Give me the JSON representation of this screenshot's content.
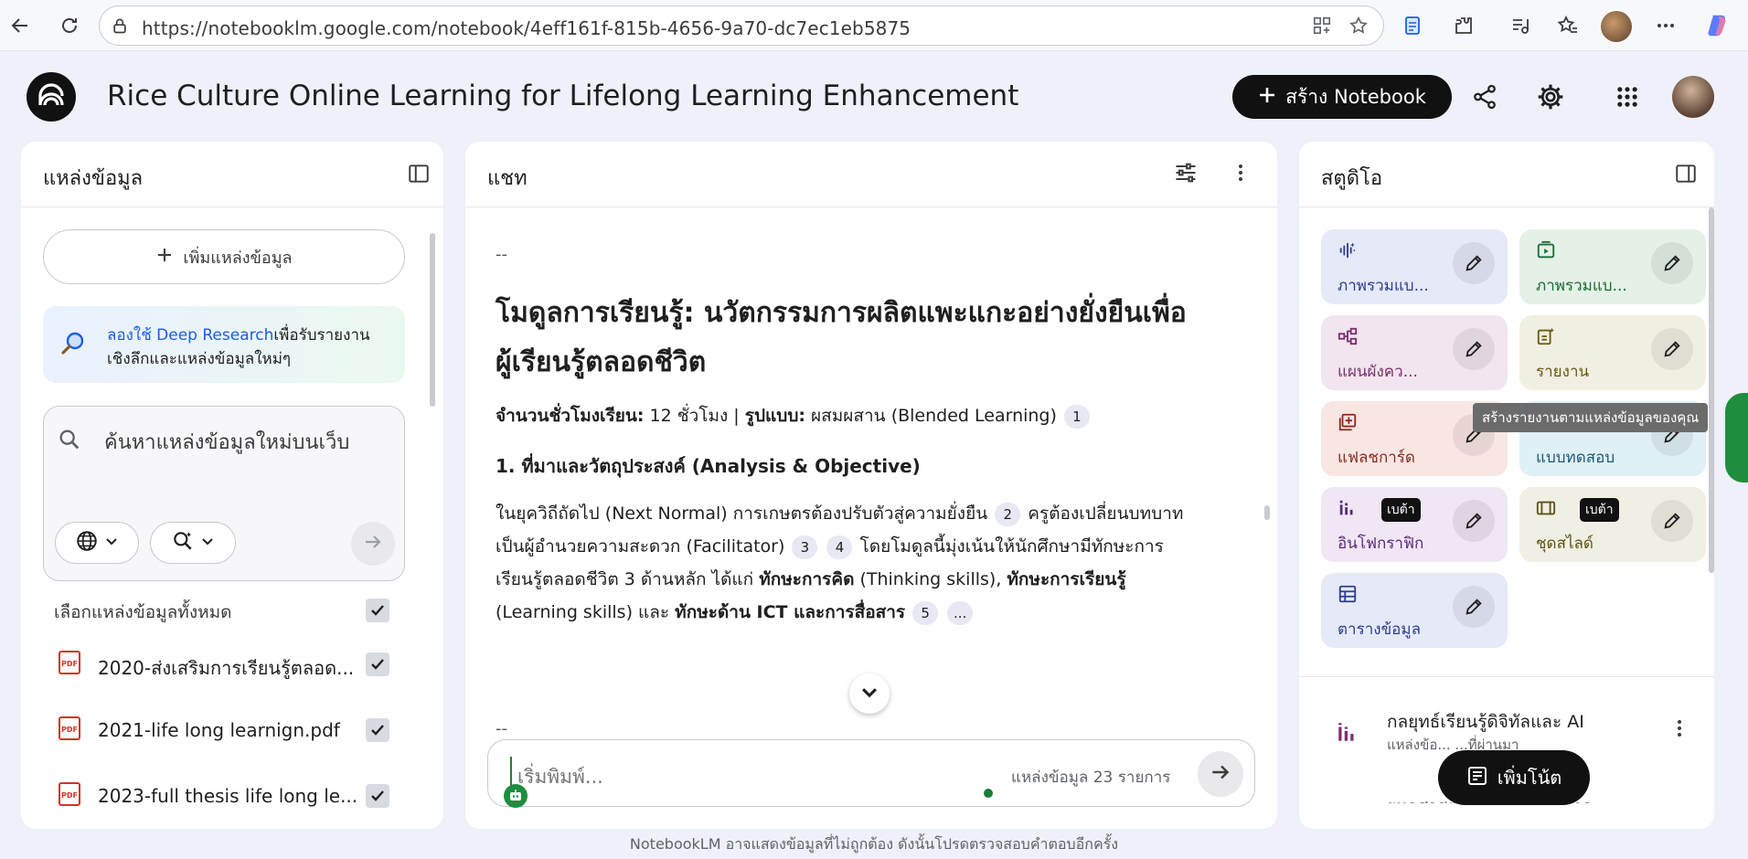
{
  "browser": {
    "url": "https://notebooklm.google.com/notebook/4eff161f-815b-4656-9a70-dc7ec1eb5875"
  },
  "header": {
    "title": "Rice Culture Online Learning for Lifelong Learning Enhancement",
    "create_label": "สร้าง Notebook"
  },
  "sources": {
    "title": "แหล่งข้อมูล",
    "add_label": "เพิ่มแหล่งข้อมูล",
    "deep_link": "ลองใช้ Deep Research",
    "deep_text": "เพื่อรับรายงาน",
    "deep_text2": "เชิงลึกและแหล่งข้อมูลใหม่ๆ",
    "search_placeholder": "ค้นหาแหล่งข้อมูลใหม่บนเว็บ",
    "select_all": "เลือกแหล่งข้อมูลทั้งหมด",
    "items": [
      {
        "name": "2020-ส่งเสริมการเรียนรู้ตลอด..."
      },
      {
        "name": "2021-life long learnign.pdf"
      },
      {
        "name": "2023-full thesis life long le..."
      }
    ]
  },
  "chat": {
    "title": "แชท",
    "dash_top": "--",
    "heading": "โมดูลการเรียนรู้: นวัตกรรมการผลิตแพะแกะอย่างยั่งยืนเพื่อผู้เรียนรู้ตลอดชีวิต",
    "meta_label1": "จำนวนชั่วโมงเรียน:",
    "meta_val1": " 12 ชั่วโมง | ",
    "meta_label2": "รูปแบบ:",
    "meta_val2": " ผสมผสาน (Blended Learning) ",
    "cite1": "1",
    "section": "1. ที่มาและวัตถุประสงค์ (Analysis & Objective)",
    "para_a": "ในยุควิถีถัดไป (Next Normal) การเกษตรต้องปรับตัวสู่ความยั่งยืน ",
    "cite2": "2",
    "para_b": " ครูต้องเปลี่ยนบทบาทเป็นผู้อำนวยความสะดวก (Facilitator) ",
    "cite3": "3",
    "cite4": "4",
    "para_c": " โดยโมดูลนี้มุ่งเน้นให้นักศึกษามีทักษะการเรียนรู้ตลอดชีวิต 3 ด้านหลัก ได้แก่ ",
    "bold1": "ทักษะการคิด",
    "para_d": " (Thinking skills), ",
    "bold2": "ทักษะการเรียนรู้",
    "para_e": " (Learning skills) และ ",
    "bold3": "ทักษะด้าน ICT และการสื่อสาร",
    "cite5": "5",
    "cite_more": "...",
    "dash_line": "------------------------------------------------------------------------------------------------------",
    "dash_bottom": "--",
    "input_placeholder": "เริ่มพิมพ์...",
    "source_count": "แหล่งข้อมูล 23 รายการ"
  },
  "studio": {
    "title": "สตูดิโอ",
    "tiles": [
      {
        "label": "ภาพรวมแบ...",
        "icon": "audio-overview-icon",
        "bg": "#e6e9f8",
        "color": "#2c3e8f"
      },
      {
        "label": "ภาพรวมแบ...",
        "icon": "video-overview-icon",
        "bg": "#e3f1e7",
        "color": "#1e6b34"
      },
      {
        "label": "แผนผังคว...",
        "icon": "mindmap-icon",
        "bg": "#f1e5ef",
        "color": "#7d2d6e"
      },
      {
        "label": "รายงาน",
        "icon": "report-icon",
        "bg": "#f1efe2",
        "color": "#6b5a12"
      },
      {
        "label": "แฟลชการ์ด",
        "icon": "flashcard-icon",
        "bg": "#f8e6e3",
        "color": "#8a2b1f"
      },
      {
        "label": "แบบทดสอบ",
        "icon": "quiz-icon",
        "bg": "#dff0f6",
        "color": "#1b5b78"
      },
      {
        "label": "อินโฟกราฟิก",
        "icon": "infographic-icon",
        "bg": "#f0e6f4",
        "color": "#5b2a7a",
        "beta": "เบต้า"
      },
      {
        "label": "ชุดสไลด์",
        "icon": "slides-icon",
        "bg": "#f0efe3",
        "color": "#5d5418",
        "beta": "เบต้า"
      },
      {
        "label": "ตารางข้อมูล",
        "icon": "table-icon",
        "bg": "#e6e9f8",
        "color": "#2c3e8f"
      }
    ],
    "tooltip": "สร้างรายงานตามแหล่งข้อมูลของคุณ",
    "note_title": "กลยุทธ์เรียนรู้ดิจิทัลและ AI",
    "note_sub": "แหล่งข้อ... ...ที่ผ่านมา",
    "note_next": "ยุทธศาสตร์การบริหารจัดการ...",
    "add_note_label": "เพิ่มโน้ต"
  },
  "footer": {
    "disclaimer": "NotebookLM อาจแสดงข้อมูลที่ไม่ถูกต้อง ดังนั้นโปรดตรวจสอบคำตอบอีกครั้ง"
  },
  "colors": {
    "accent": "#1a5ee8",
    "pdf_red": "#d93025",
    "bot_green": "#1e8e3e"
  }
}
